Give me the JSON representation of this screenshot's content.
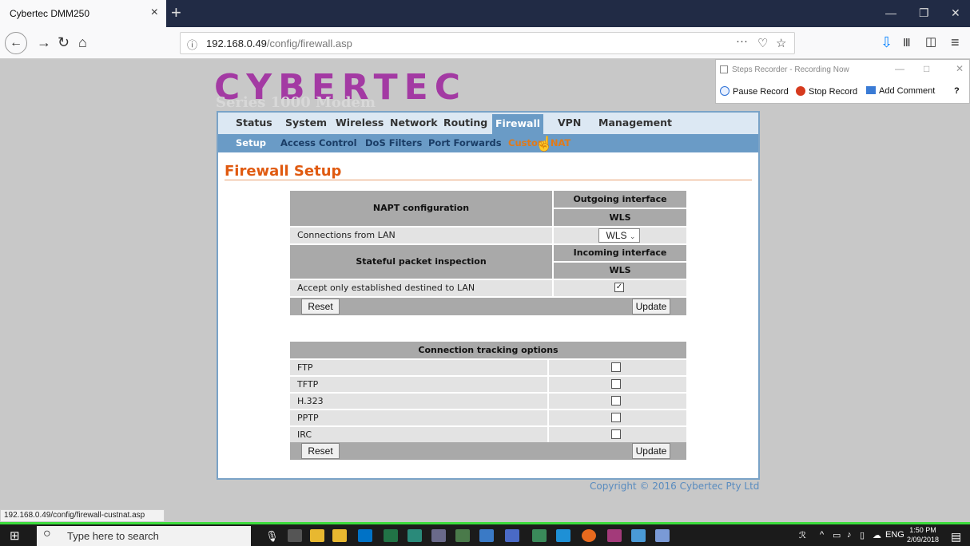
{
  "browser": {
    "tab_title": "Cybertec DMM250",
    "tab_close": "×",
    "new_tab": "+",
    "url_host": "192.168.0.49",
    "url_path": "/config/firewall.asp",
    "page_actions": "···",
    "status_url": "192.168.0.49/config/firewall-custnat.asp"
  },
  "logo": {
    "text": "CYBERTEC",
    "subtitle": "Series 1000 Modem"
  },
  "menu": {
    "top": [
      "Status",
      "System",
      "Wireless",
      "Network",
      "Routing",
      "Firewall",
      "VPN",
      "Management"
    ],
    "sub": [
      "Setup",
      "Access Control",
      "DoS Filters",
      "Port Forwards",
      "Custom NAT"
    ]
  },
  "page_title": "Firewall Setup",
  "napt": {
    "header": "NAPT configuration",
    "out_header": "Outgoing interface",
    "out_value": "WLS",
    "conn_label": "Connections from LAN",
    "conn_select": "WLS",
    "spi_header": "Stateful packet inspection",
    "in_header": "Incoming interface",
    "in_value": "WLS",
    "accept_label": "Accept only established destined to LAN",
    "accept_checked": true,
    "reset": "Reset",
    "update": "Update"
  },
  "tracking": {
    "header": "Connection tracking options",
    "options": [
      {
        "label": "FTP",
        "checked": false
      },
      {
        "label": "TFTP",
        "checked": false
      },
      {
        "label": "H.323",
        "checked": false
      },
      {
        "label": "PPTP",
        "checked": false
      },
      {
        "label": "IRC",
        "checked": false
      }
    ],
    "reset": "Reset",
    "update": "Update"
  },
  "copyright": "Copyright © 2016 Cybertec Pty Ltd",
  "steps_recorder": {
    "title": "Steps Recorder - Recording Now",
    "pause": "Pause Record",
    "stop": "Stop Record",
    "comment": "Add Comment"
  },
  "taskbar": {
    "search_placeholder": "Type here to search",
    "lang": "ENG",
    "time": "1:50 PM",
    "date": "2/09/2018"
  }
}
